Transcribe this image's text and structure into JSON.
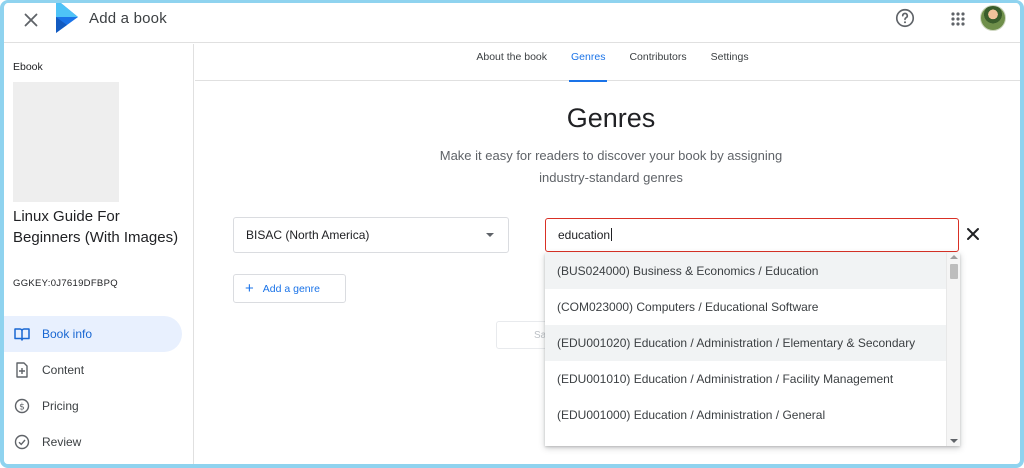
{
  "app": {
    "title": "Add a book",
    "close_icon": "close-icon",
    "logo_icon": "play-books-logo",
    "help_icon": "help-icon",
    "apps_icon": "apps-grid-icon",
    "avatar_icon": "user-avatar"
  },
  "colors": {
    "accent": "#1a73e8",
    "error": "#d93025",
    "frame": "#8fd3ef",
    "nav_active_bg": "#e8f0fe"
  },
  "sidebar": {
    "format": "Ebook",
    "book_title": "Linux Guide For Beginners (With Images)",
    "book_key": "GGKEY:0J7619DFBPQ",
    "nav": [
      {
        "label": "Book info",
        "icon": "book-info-icon",
        "active": true
      },
      {
        "label": "Content",
        "icon": "content-icon",
        "active": false
      },
      {
        "label": "Pricing",
        "icon": "pricing-icon",
        "active": false
      },
      {
        "label": "Review",
        "icon": "review-icon",
        "active": false
      }
    ]
  },
  "tabs": [
    {
      "label": "About the book",
      "active": false
    },
    {
      "label": "Genres",
      "active": true
    },
    {
      "label": "Contributors",
      "active": false
    },
    {
      "label": "Settings",
      "active": false
    }
  ],
  "main": {
    "heading": "Genres",
    "subheading": "Make it easy for readers to discover your book by assigning industry-standard genres",
    "genre_system": "BISAC (North America)",
    "search_value": "education",
    "add_genre_label": "Add a genre",
    "save_label": "Sa"
  },
  "dropdown": {
    "items": [
      {
        "label": "(BUS024000) Business & Economics / Education",
        "highlighted": true
      },
      {
        "label": "(COM023000) Computers / Educational Software",
        "highlighted": false
      },
      {
        "label": "(EDU001020) Education / Administration / Elementary & Secondary",
        "highlighted": true
      },
      {
        "label": "(EDU001010) Education / Administration / Facility Management",
        "highlighted": false
      },
      {
        "label": "(EDU001000) Education / Administration / General",
        "highlighted": false
      }
    ]
  }
}
